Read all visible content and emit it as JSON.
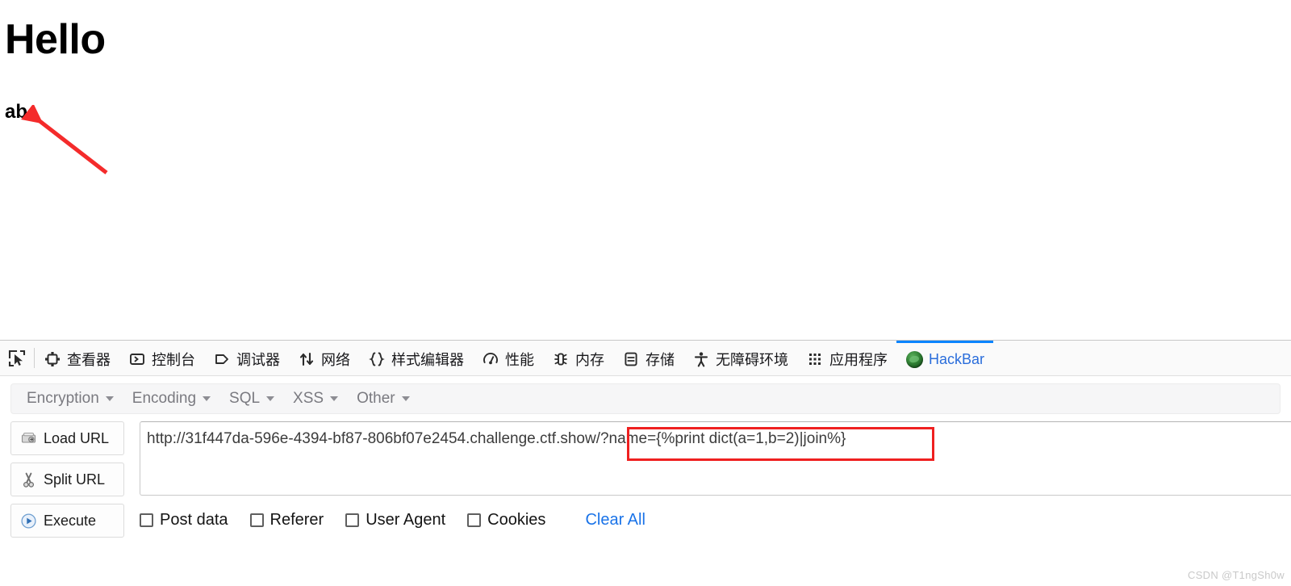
{
  "page": {
    "heading": "Hello",
    "output": "ab",
    "annotation_arrow_color": "#ef2020"
  },
  "devtools": {
    "picker_icon": "element-picker-icon",
    "tabs": [
      {
        "label": "查看器",
        "icon": "inspector-icon",
        "active": false
      },
      {
        "label": "控制台",
        "icon": "console-icon",
        "active": false
      },
      {
        "label": "调试器",
        "icon": "debugger-icon",
        "active": false
      },
      {
        "label": "网络",
        "icon": "network-icon",
        "active": false
      },
      {
        "label": "样式编辑器",
        "icon": "style-editor-icon",
        "active": false
      },
      {
        "label": "性能",
        "icon": "performance-icon",
        "active": false
      },
      {
        "label": "内存",
        "icon": "memory-icon",
        "active": false
      },
      {
        "label": "存储",
        "icon": "storage-icon",
        "active": false
      },
      {
        "label": "无障碍环境",
        "icon": "accessibility-icon",
        "active": false
      },
      {
        "label": "应用程序",
        "icon": "application-icon",
        "active": false
      },
      {
        "label": "HackBar",
        "icon": "hackbar-icon",
        "active": true
      }
    ],
    "active_tab_accent": "#0a84ff"
  },
  "hackbar": {
    "menus": [
      {
        "label": "Encryption"
      },
      {
        "label": "Encoding"
      },
      {
        "label": "SQL"
      },
      {
        "label": "XSS"
      },
      {
        "label": "Other"
      }
    ],
    "buttons": [
      {
        "label": "Load URL",
        "icon": "load-url-icon"
      },
      {
        "label": "Split URL",
        "icon": "scissors-icon"
      },
      {
        "label": "Execute",
        "icon": "play-icon"
      }
    ],
    "url_value": "http://31f447da-596e-4394-bf87-806bf07e2454.challenge.ctf.show/?name={%print dict(a=1,b=2)|join%}",
    "url_placeholder": "",
    "checkboxes": [
      {
        "label": "Post data",
        "checked": false
      },
      {
        "label": "Referer",
        "checked": false
      },
      {
        "label": "User Agent",
        "checked": false
      },
      {
        "label": "Cookies",
        "checked": false
      }
    ],
    "clear_all_label": "Clear All",
    "clear_all_color": "#1a73e8"
  },
  "watermark": {
    "text": "CSDN @T1ngSh0w"
  }
}
